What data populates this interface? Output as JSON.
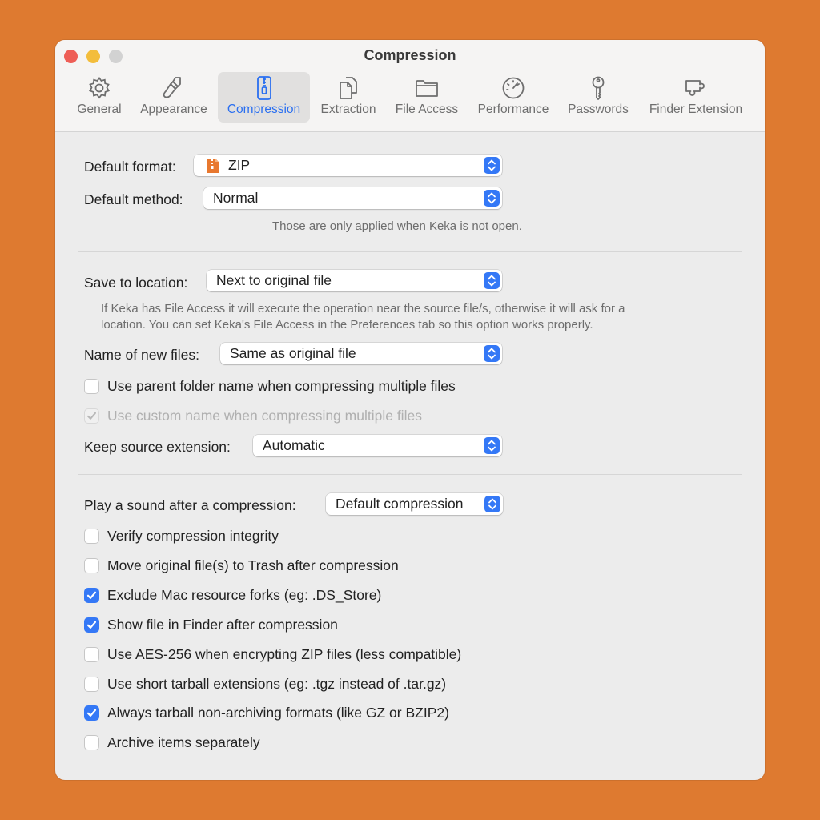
{
  "window": {
    "title": "Compression"
  },
  "tabs": [
    {
      "label": "General",
      "icon": "gear-icon"
    },
    {
      "label": "Appearance",
      "icon": "paintbrush-icon"
    },
    {
      "label": "Compression",
      "icon": "zipper-icon",
      "active": true
    },
    {
      "label": "Extraction",
      "icon": "documents-icon"
    },
    {
      "label": "File Access",
      "icon": "folder-icon"
    },
    {
      "label": "Performance",
      "icon": "speedometer-icon"
    },
    {
      "label": "Passwords",
      "icon": "key-icon"
    },
    {
      "label": "Finder Extension",
      "icon": "puzzle-icon"
    }
  ],
  "format": {
    "label": "Default format:",
    "value": "ZIP",
    "icon": "zip-file-icon"
  },
  "method": {
    "label": "Default method:",
    "value": "Normal"
  },
  "format_note": "Those are only applied when Keka is not open.",
  "location": {
    "label": "Save to location:",
    "value": "Next to original file",
    "note_line1": "If Keka has File Access it will execute the operation near the source file/s, otherwise it will ask for a",
    "note_line2": "location. You can set Keka's File Access in the Preferences tab so this option works properly."
  },
  "naming": {
    "label": "Name of new files:",
    "value": "Same as original file"
  },
  "parent_folder": {
    "label": "Use parent folder name when compressing multiple files",
    "checked": false
  },
  "custom_name": {
    "label": "Use custom name when compressing multiple files",
    "checked": true,
    "disabled": true
  },
  "extension": {
    "label": "Keep source extension:",
    "value": "Automatic"
  },
  "sound": {
    "label": "Play a sound after a compression:",
    "value": "Default compression"
  },
  "options": [
    {
      "label": "Verify compression integrity",
      "checked": false
    },
    {
      "label": "Move original file(s) to Trash after compression",
      "checked": false
    },
    {
      "label": "Exclude Mac resource forks (eg: .DS_Store)",
      "checked": true
    },
    {
      "label": "Show file in Finder after compression",
      "checked": true
    },
    {
      "label": "Use AES-256 when encrypting ZIP files (less compatible)",
      "checked": false
    },
    {
      "label": "Use short tarball extensions (eg: .tgz instead of .tar.gz)",
      "checked": false
    },
    {
      "label": "Always tarball non-archiving formats (like GZ or BZIP2)",
      "checked": true
    },
    {
      "label": "Archive items separately",
      "checked": false
    }
  ],
  "colors": {
    "accent": "#3478f6",
    "background": "#de7a30",
    "window": "#ececec"
  }
}
